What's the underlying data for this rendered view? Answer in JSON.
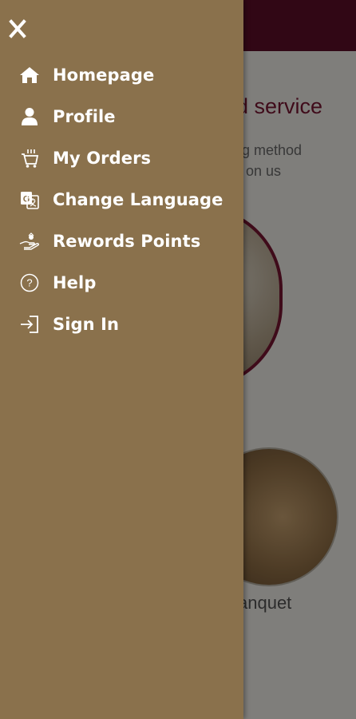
{
  "background": {
    "title": "d service",
    "description_line1": "ting method",
    "description_line2": "on us",
    "caption": "anquet"
  },
  "drawer": {
    "close_icon": "close-icon",
    "items": [
      {
        "label": "Homepage",
        "icon": "home-icon"
      },
      {
        "label": "Profile",
        "icon": "user-icon"
      },
      {
        "label": "My Orders",
        "icon": "cart-icon"
      },
      {
        "label": "Change Language",
        "icon": "translate-icon"
      },
      {
        "label": "Rewords Points",
        "icon": "reward-hand-icon"
      },
      {
        "label": "Help",
        "icon": "help-icon"
      },
      {
        "label": "Sign In",
        "icon": "sign-in-icon"
      }
    ]
  },
  "colors": {
    "drawer_bg": "#8a714c",
    "header_bg": "#5e0f2a",
    "accent": "#7a1633",
    "text": "#ffffff"
  }
}
